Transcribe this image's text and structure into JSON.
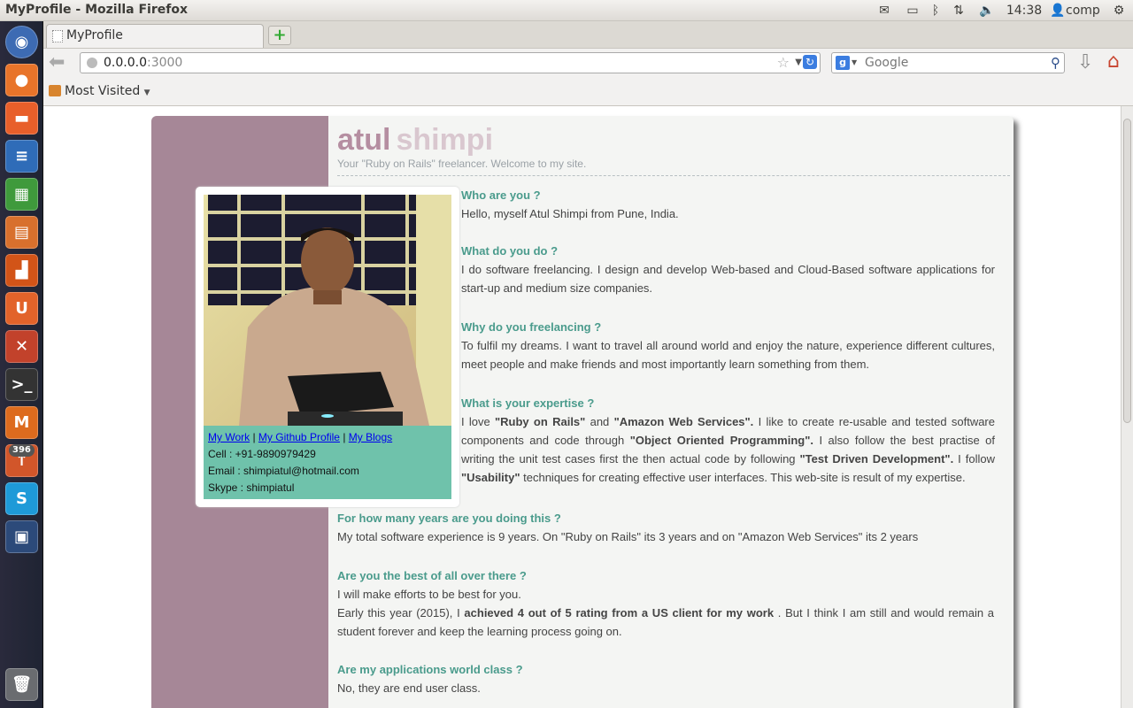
{
  "topbar": {
    "window_title": "MyProfile - Mozilla Firefox",
    "time": "14:38",
    "user": "comp",
    "badge": "396"
  },
  "browser": {
    "tab_title": "MyProfile",
    "url_host": "0.0.0.0",
    "url_port": ":3000",
    "search_placeholder": "Google",
    "bookmarks_label": "Most Visited"
  },
  "profile": {
    "first_name": "atul",
    "last_name": "shimpi",
    "tagline": "Your \"Ruby on Rails\" freelancer. Welcome to my site.",
    "links": {
      "work": "My Work",
      "github": "My Github Profile",
      "blogs": "My Blogs",
      "sep": "|"
    },
    "cell": "Cell : +91-9890979429",
    "email": "Email : shimpiatul@hotmail.com",
    "skype": "Skype : shimpiatul"
  },
  "qa": [
    {
      "q": "Who are you ?",
      "a": "Hello, myself Atul Shimpi from Pune, India."
    },
    {
      "q": "What do you do ?",
      "a": "I do software freelancing. I design and develop Web-based and Cloud-Based software applications for start-up and medium size companies."
    },
    {
      "q": "Why do you freelancing ?",
      "a": "To fulfil my dreams. I want to travel all around world and enjoy the nature, experience different cultures, meet people and make friends and most importantly learn something from them."
    },
    {
      "q": "What is your expertise ?",
      "a_parts": [
        "I love ",
        "\"Ruby on Rails\"",
        " and ",
        "\"Amazon Web Services\".",
        " I like to create re-usable and tested software components and code through ",
        "\"Object Oriented Programming\".",
        " I also follow the best practise of writing the unit test cases first the then actual code by following ",
        "\"Test Driven Development\".",
        " I follow ",
        "\"Usability\"",
        " techniques for creating effective user interfaces. This web-site is result of my expertise."
      ]
    },
    {
      "q": "For how many years are you doing this ?",
      "a": "My total software experience is 9 years. On \"Ruby on Rails\" its 3 years and on \"Amazon Web Services\" its 2 years"
    },
    {
      "q": "Are you the best of all over there ?",
      "a": "I will make efforts to be best for you.",
      "a2_parts": [
        "Early this year (2015), I ",
        "achieved 4 out of 5 rating from a US client for my work",
        " . But I think I am still and would remain a student forever and keep the learning process going on."
      ]
    },
    {
      "q": "Are my applications world class ?",
      "a": "No, they are end user class."
    }
  ]
}
